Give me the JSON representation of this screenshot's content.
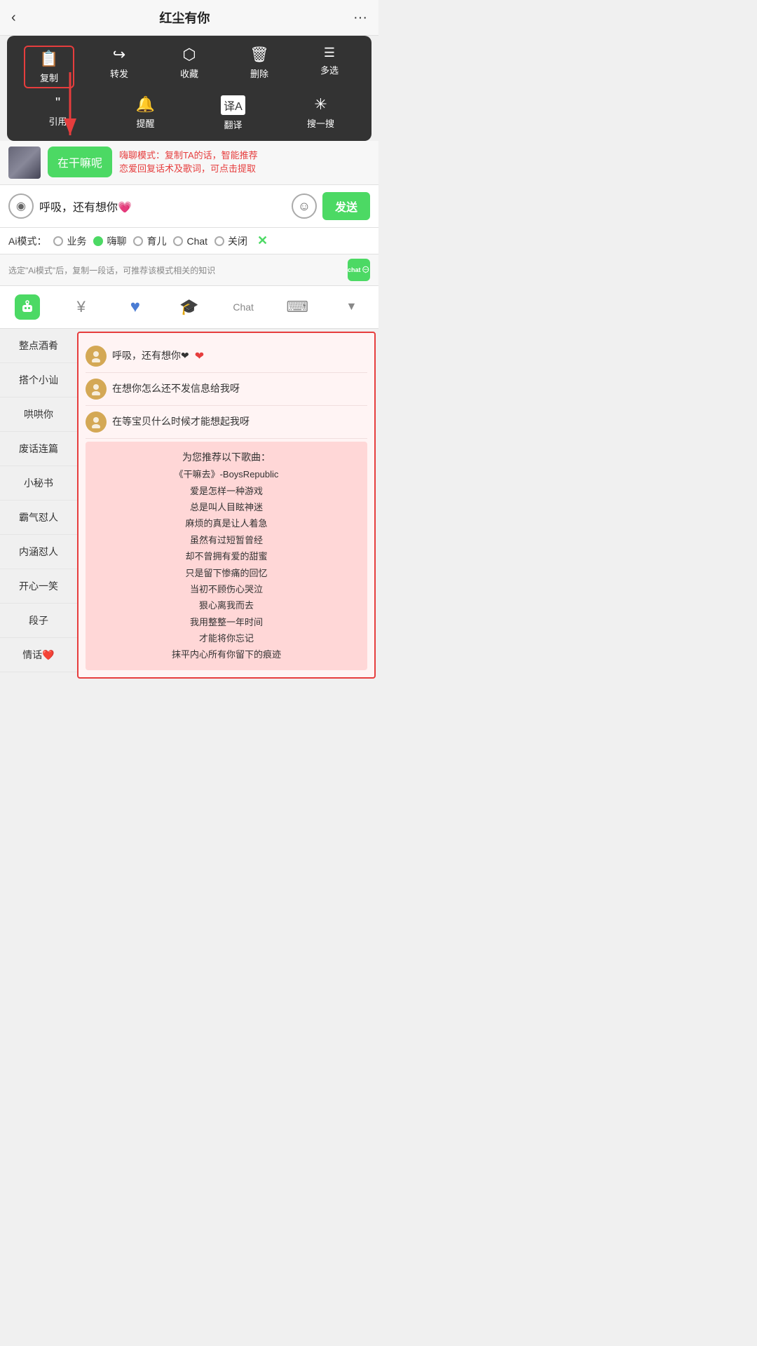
{
  "header": {
    "title": "红尘有你",
    "back_icon": "‹",
    "more_icon": "···"
  },
  "context_menu": {
    "row1": [
      {
        "icon": "📄",
        "label": "复制",
        "highlighted": true
      },
      {
        "icon": "↪",
        "label": "转发",
        "highlighted": false
      },
      {
        "icon": "⬡",
        "label": "收藏",
        "highlighted": false
      },
      {
        "icon": "🗑",
        "label": "删除",
        "highlighted": false
      },
      {
        "icon": "≡",
        "label": "多选",
        "highlighted": false
      }
    ],
    "row2": [
      {
        "icon": "❝",
        "label": "引用",
        "highlighted": false
      },
      {
        "icon": "🔔",
        "label": "提醒",
        "highlighted": false
      },
      {
        "icon": "译",
        "label": "翻译",
        "highlighted": false
      },
      {
        "icon": "✳",
        "label": "搜一搜",
        "highlighted": false
      }
    ]
  },
  "chat_message": {
    "bubble_text": "在干嘛呢",
    "annotation_text": "嗨聊模式：复制TA的话，智能推荐\n恋爱回复话术及歌词，可点击提取"
  },
  "input_area": {
    "voice_icon": "◉",
    "input_value": "呼吸，还有想你💗",
    "emoji_icon": "☺",
    "send_label": "发送"
  },
  "ai_modes": {
    "label": "Ai模式：",
    "options": [
      {
        "label": "业务",
        "active": false
      },
      {
        "label": "嗨聊",
        "active": true
      },
      {
        "label": "育儿",
        "active": false
      },
      {
        "label": "Chat",
        "active": false
      },
      {
        "label": "关闭",
        "active": false
      }
    ],
    "close_icon": "✕"
  },
  "hint_bar": {
    "text": "选定\"Ai模式\"后，复制一段话，可推荐该模式相关的知识",
    "icon_label": "chat"
  },
  "tabs": [
    {
      "icon": "robot",
      "label": "chat"
    },
    {
      "icon": "¥",
      "label": "money"
    },
    {
      "icon": "♥",
      "label": "heart"
    },
    {
      "icon": "🎓",
      "label": "graduate"
    },
    {
      "icon": "Chat",
      "label": "chat-text"
    },
    {
      "icon": "⌨",
      "label": "keyboard"
    },
    {
      "icon": "▼",
      "label": "down"
    }
  ],
  "sidebar_items": [
    {
      "label": "整点酒肴"
    },
    {
      "label": "搭个小讪"
    },
    {
      "label": "哄哄你"
    },
    {
      "label": "废话连篇"
    },
    {
      "label": "小秘书"
    },
    {
      "label": "霸气怼人"
    },
    {
      "label": "内涵怼人"
    },
    {
      "label": "开心一笑"
    },
    {
      "label": "段子"
    },
    {
      "label": "情话❤️"
    }
  ],
  "suggestions": [
    {
      "text": "呼吸，还有想你❤"
    },
    {
      "text": "在想你怎么还不发信息给我呀"
    },
    {
      "text": "在等宝贝什么时候才能想起我呀"
    }
  ],
  "songs": {
    "header": "为您推荐以下歌曲：",
    "list": [
      "《干嘛去》-BoysRepublic",
      "爱是怎样一种游戏",
      "总是叫人目眩神迷",
      "麻烦的真是让人着急",
      "虽然有过短暂曾经",
      "却不曾拥有爱的甜蜜",
      "只是留下惨痛的回忆",
      "当初不顾伤心哭泣",
      "狠心离我而去",
      "我用整整一年时间",
      "才能将你忘记",
      "抹平内心所有你留下的痕迹"
    ]
  }
}
